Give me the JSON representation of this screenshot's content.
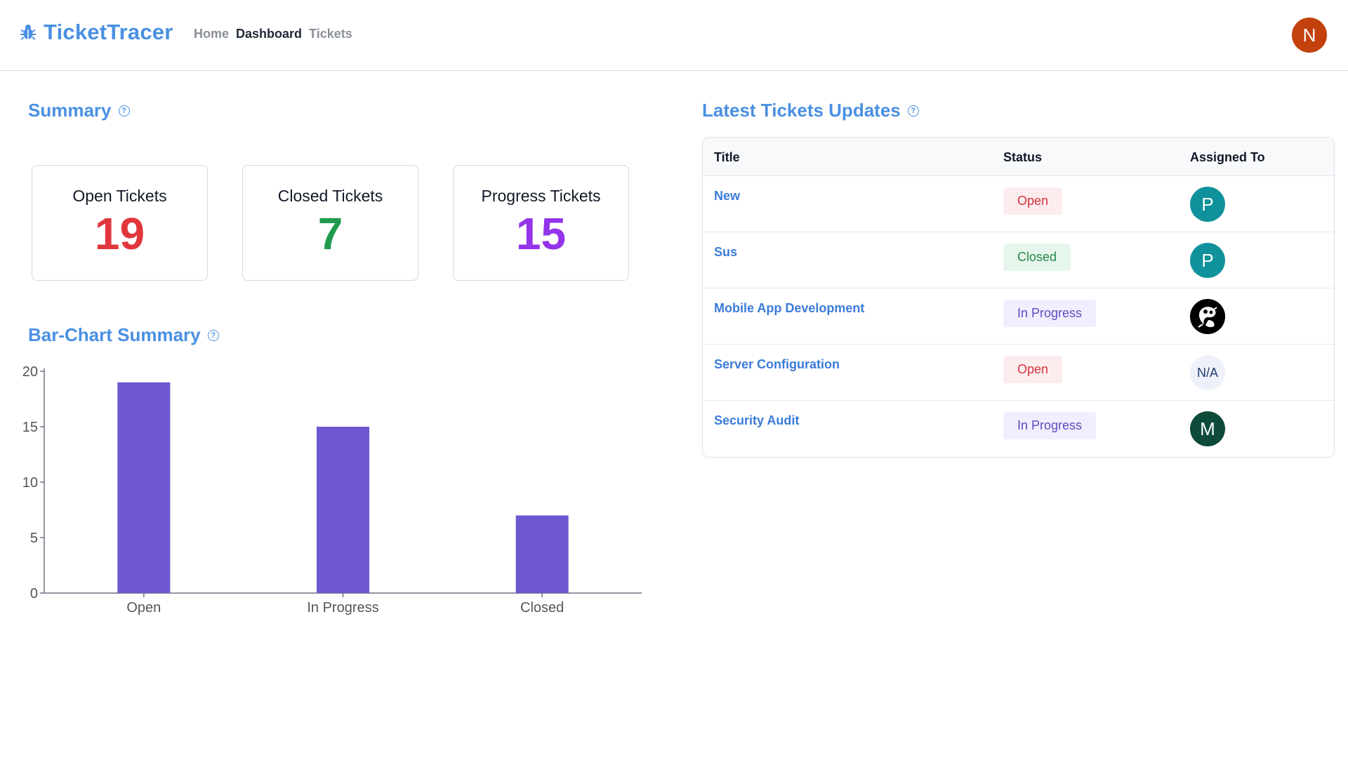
{
  "app": {
    "name": "TicketTracer",
    "icon": "bug-icon",
    "brand_color": "#4a90e2"
  },
  "nav": {
    "items": [
      {
        "label": "Home",
        "active": false
      },
      {
        "label": "Dashboard",
        "active": true
      },
      {
        "label": "Tickets",
        "active": false
      }
    ]
  },
  "user": {
    "initial": "N",
    "avatar_color": "#c2410c"
  },
  "summary": {
    "title": "Summary",
    "cards": [
      {
        "label": "Open Tickets",
        "value": "19",
        "color": "#e0373d"
      },
      {
        "label": "Closed Tickets",
        "value": "7",
        "color": "#1f9a4e"
      },
      {
        "label": "Progress Tickets",
        "value": "15",
        "color": "#9333ea"
      }
    ]
  },
  "barchart": {
    "title": "Bar-Chart Summary"
  },
  "chart_data": {
    "type": "bar",
    "categories": [
      "Open",
      "In Progress",
      "Closed"
    ],
    "values": [
      19,
      15,
      7
    ],
    "ylim": [
      0,
      20
    ],
    "yticks": [
      0,
      5,
      10,
      15,
      20
    ],
    "bar_color": "#6e56cf",
    "grid": false
  },
  "latest": {
    "title": "Latest Tickets Updates",
    "columns": [
      "Title",
      "Status",
      "Assigned To"
    ],
    "rows": [
      {
        "title": "New",
        "status": "Open",
        "status_type": "open",
        "assignee": "P",
        "assignee_style": "teal"
      },
      {
        "title": "Sus",
        "status": "Closed",
        "status_type": "closed",
        "assignee": "P",
        "assignee_style": "teal"
      },
      {
        "title": "Mobile App Development",
        "status": "In Progress",
        "status_type": "progress",
        "assignee": "",
        "assignee_style": "photo"
      },
      {
        "title": "Server Configuration",
        "status": "Open",
        "status_type": "open",
        "assignee": "N/A",
        "assignee_style": "na"
      },
      {
        "title": "Security Audit",
        "status": "In Progress",
        "status_type": "progress",
        "assignee": "M",
        "assignee_style": "green"
      }
    ]
  }
}
